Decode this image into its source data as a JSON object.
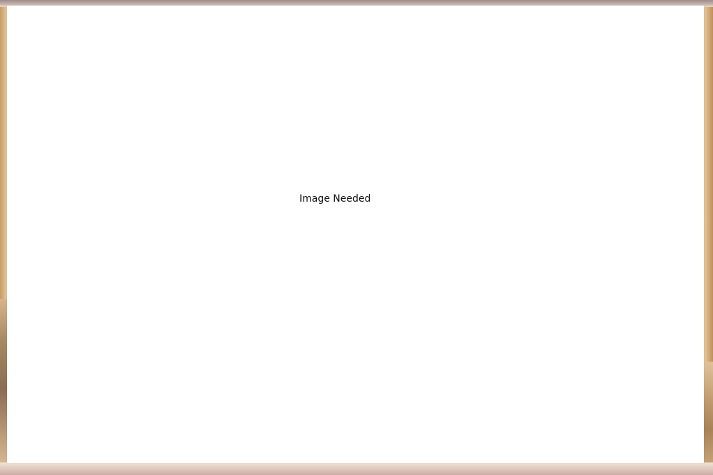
{
  "placeholder": {
    "text": "Image Needed"
  },
  "colors": {
    "card_background": "#ffffff",
    "backdrop_tone": "#ead4b4",
    "text": "#111111"
  }
}
